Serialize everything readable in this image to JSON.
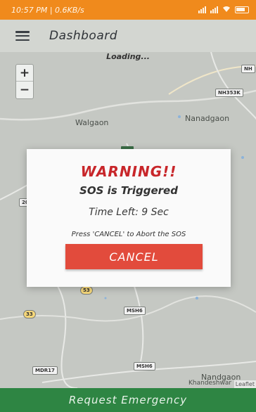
{
  "status_bar": {
    "time_text": "10:57 PM | 0.6KB/s",
    "bg_color": "#f08a1c"
  },
  "app_bar": {
    "menu_icon": "hamburger-icon",
    "title": "Dashboard"
  },
  "map": {
    "loading_text": "Loading...",
    "zoom_in": "+",
    "zoom_out": "−",
    "places": {
      "walgaon": "Walgaon",
      "nanadgaon": "Nanadgaon",
      "nandgaon": "Nandgaon",
      "khandeshwar": "Khandeshwar"
    },
    "road_tags": {
      "nh353k": "NH353K",
      "nh_top": "NH",
      "msh6_a": "MSH6",
      "msh6_b": "MSH6",
      "mdr17": "MDR17",
      "sh53": "53",
      "sh33": "33",
      "r20": "20"
    },
    "attribution": "Leaflet"
  },
  "dialog": {
    "warning": "WARNING!!",
    "message": "SOS is Triggered",
    "time_left": "Time Left: 9 Sec",
    "instruction": "Press 'CANCEL' to Abort the SOS",
    "cancel_label": "CANCEL",
    "warning_color": "#c8262a",
    "cancel_color": "#e24b3c"
  },
  "bottom": {
    "request_label": "Request Emergency",
    "color": "#2e8543"
  }
}
